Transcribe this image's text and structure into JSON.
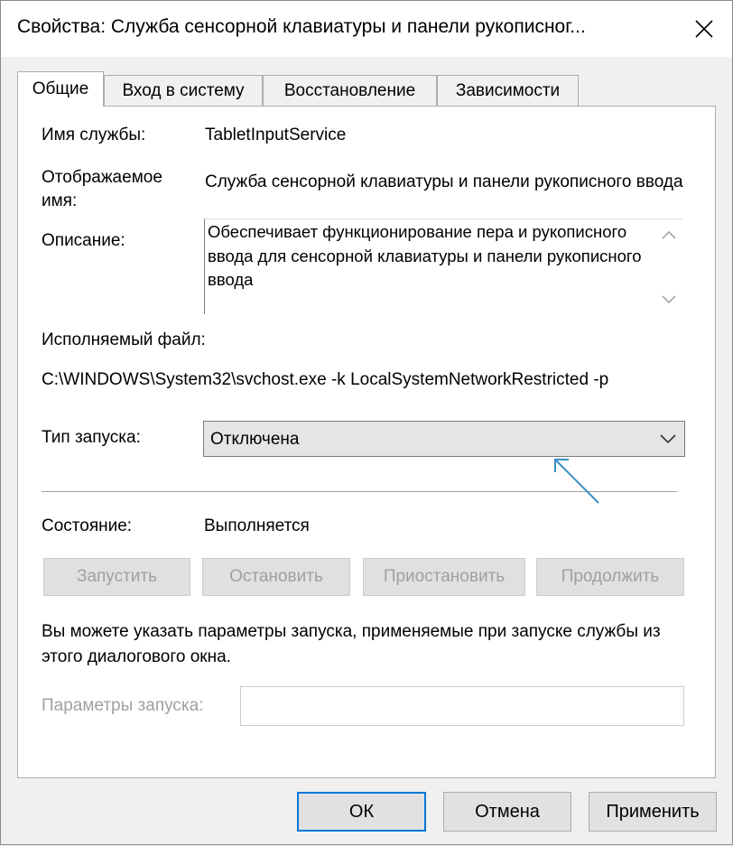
{
  "window": {
    "title": "Свойства: Служба сенсорной клавиатуры и панели рукописног...",
    "close_glyph": "✕"
  },
  "tabs": [
    {
      "label": "Общие",
      "active": true
    },
    {
      "label": "Вход в систему",
      "active": false
    },
    {
      "label": "Восстановление",
      "active": false
    },
    {
      "label": "Зависимости",
      "active": false
    }
  ],
  "general": {
    "service_name_label": "Имя службы:",
    "service_name_value": "TabletInputService",
    "display_name_label_line1": "Отображаемое",
    "display_name_label_line2": "имя:",
    "display_name_value": "Служба сенсорной клавиатуры и панели рукописного ввода",
    "description_label": "Описание:",
    "description_value": "Обеспечивает функционирование пера и рукописного ввода для сенсорной клавиатуры и панели рукописного ввода",
    "executable_label": "Исполняемый файл:",
    "executable_value": "C:\\WINDOWS\\System32\\svchost.exe -k LocalSystemNetworkRestricted -p",
    "startup_type_label": "Тип запуска:",
    "startup_type_value": "Отключена",
    "status_label": "Состояние:",
    "status_value": "Выполняется",
    "buttons": {
      "start": "Запустить",
      "stop": "Остановить",
      "pause": "Приостановить",
      "resume": "Продолжить"
    },
    "hint_text": "Вы можете указать параметры запуска, применяемые при запуске службы из этого диалогового окна.",
    "params_label": "Параметры запуска:",
    "params_value": ""
  },
  "footer": {
    "ok": "ОК",
    "cancel": "Отмена",
    "apply": "Применить"
  },
  "colors": {
    "accent": "#0078d7",
    "annotation_arrow": "#3a8fc7",
    "disabled_text": "#a0a0a0"
  },
  "icons": {
    "close": "close-icon",
    "dropdown": "chevron-down-icon",
    "scroll_up": "chevron-up-icon",
    "scroll_down": "chevron-down-icon"
  }
}
